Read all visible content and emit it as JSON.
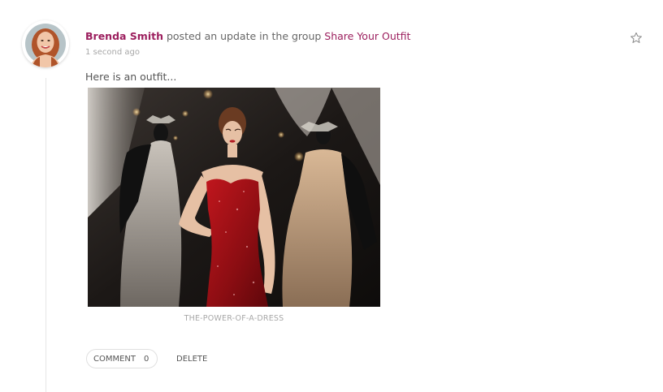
{
  "activity": {
    "author": "Brenda Smith",
    "action_text": " posted an update in the group ",
    "group": "Share Your Outfit",
    "timestamp": "1 second ago",
    "content": "Here is an outfit...",
    "image_caption": "THE-POWER-OF-A-DRESS"
  },
  "actions": {
    "comment_label": "COMMENT",
    "comment_count": "0",
    "delete_label": "DELETE"
  },
  "icons": {
    "favorite": "star-outline-icon"
  },
  "colors": {
    "link": "#9c1f5e",
    "text": "#555555",
    "muted": "#a8a8a8"
  }
}
